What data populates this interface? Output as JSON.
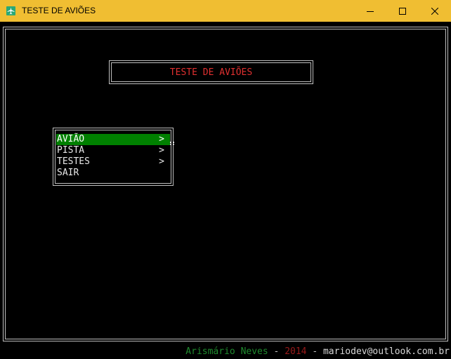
{
  "window": {
    "title": "TESTE DE AVIÕES",
    "icon": "airplane-icon",
    "titlebar_color": "#f0be32"
  },
  "console": {
    "header_title": "TESTE DE AVIÕES",
    "header_color": "#e03030",
    "menu": [
      {
        "label": "AVIÃO",
        "arrow": ">",
        "selected": true
      },
      {
        "label": "PISTA",
        "arrow": ">",
        "selected": false
      },
      {
        "label": "TESTES",
        "arrow": ">",
        "selected": false
      },
      {
        "label": "SAIR",
        "arrow": "",
        "selected": false
      }
    ],
    "selection_color": "#008000",
    "footer": {
      "author": "Arismário Neves",
      "sep1": " - ",
      "year": "2014",
      "sep2": " - ",
      "email": "mariodev@outlook.com.br"
    }
  }
}
